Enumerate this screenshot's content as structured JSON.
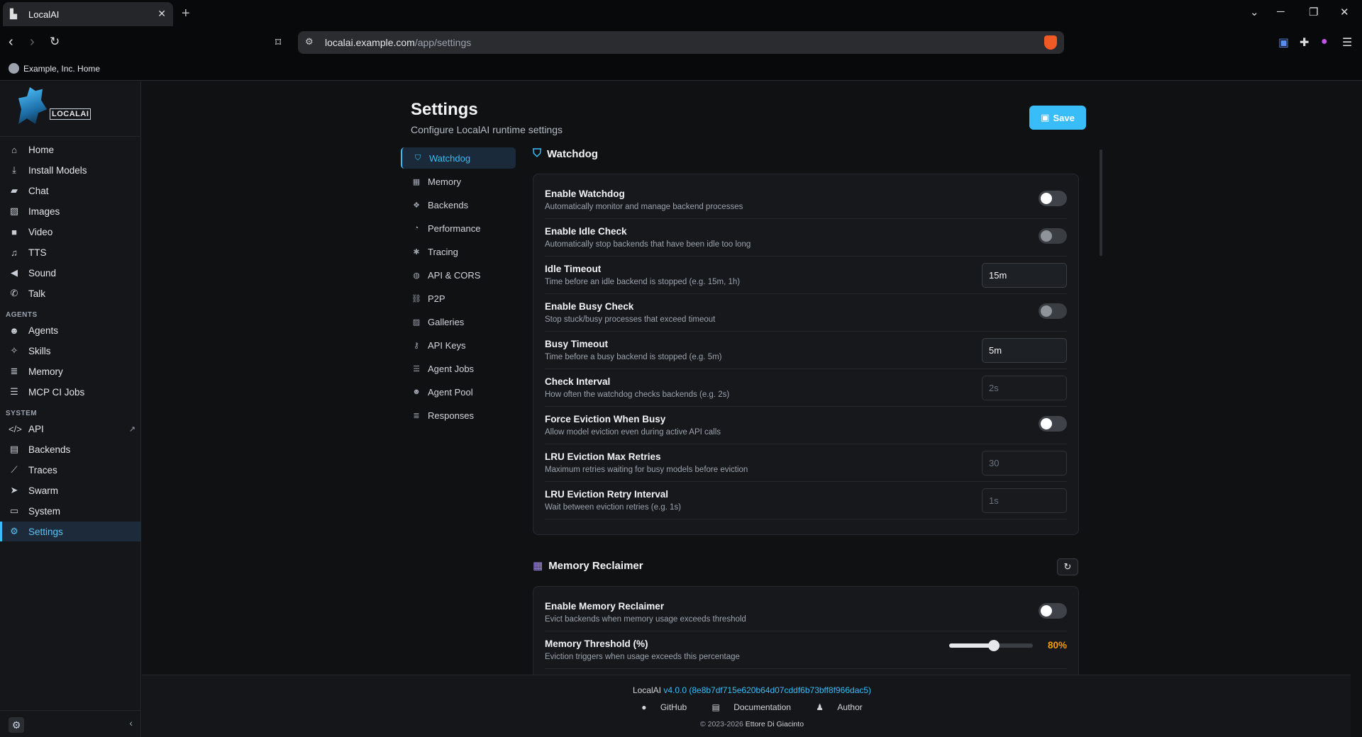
{
  "browser": {
    "tab_title": "LocalAI",
    "url_host": "localai.example.com",
    "url_path": "/app/settings",
    "bookmark": "Example, Inc. Home"
  },
  "sidebar": {
    "logo_text": "LOCALAI",
    "items": [
      {
        "label": "Home",
        "icon": "home-icon"
      },
      {
        "label": "Install Models",
        "icon": "download-icon"
      },
      {
        "label": "Chat",
        "icon": "chat-icon"
      },
      {
        "label": "Images",
        "icon": "image-icon"
      },
      {
        "label": "Video",
        "icon": "video-icon"
      },
      {
        "label": "TTS",
        "icon": "music-icon"
      },
      {
        "label": "Sound",
        "icon": "speaker-icon"
      },
      {
        "label": "Talk",
        "icon": "phone-icon"
      }
    ],
    "agents_heading": "AGENTS",
    "agents_items": [
      {
        "label": "Agents",
        "icon": "robot-icon"
      },
      {
        "label": "Skills",
        "icon": "wand-icon"
      },
      {
        "label": "Memory",
        "icon": "database-icon"
      },
      {
        "label": "MCP CI Jobs",
        "icon": "list-icon"
      }
    ],
    "system_heading": "SYSTEM",
    "system_items": [
      {
        "label": "API",
        "icon": "code-icon"
      },
      {
        "label": "Backends",
        "icon": "server-icon"
      },
      {
        "label": "Traces",
        "icon": "chart-line-icon"
      },
      {
        "label": "Swarm",
        "icon": "send-icon"
      },
      {
        "label": "System",
        "icon": "monitor-icon"
      },
      {
        "label": "Settings",
        "icon": "gear-icon"
      }
    ],
    "active": "Settings"
  },
  "page": {
    "title": "Settings",
    "subtitle": "Configure LocalAI runtime settings",
    "save_label": "Save"
  },
  "subnav": [
    {
      "label": "Watchdog",
      "icon": "shield-icon"
    },
    {
      "label": "Memory",
      "icon": "memory-icon"
    },
    {
      "label": "Backends",
      "icon": "cubes-icon"
    },
    {
      "label": "Performance",
      "icon": "gauge-icon"
    },
    {
      "label": "Tracing",
      "icon": "bug-icon"
    },
    {
      "label": "API & CORS",
      "icon": "globe-icon"
    },
    {
      "label": "P2P",
      "icon": "network-icon"
    },
    {
      "label": "Galleries",
      "icon": "images-icon"
    },
    {
      "label": "API Keys",
      "icon": "key-icon"
    },
    {
      "label": "Agent Jobs",
      "icon": "list-check-icon"
    },
    {
      "label": "Agent Pool",
      "icon": "users-icon"
    },
    {
      "label": "Responses",
      "icon": "database-icon"
    }
  ],
  "watchdog": {
    "title": "Watchdog",
    "rows": [
      {
        "label": "Enable Watchdog",
        "desc": "Automatically monitor and manage backend processes",
        "type": "toggle",
        "enabled": true
      },
      {
        "label": "Enable Idle Check",
        "desc": "Automatically stop backends that have been idle too long",
        "type": "toggle",
        "enabled": false
      },
      {
        "label": "Idle Timeout",
        "desc": "Time before an idle backend is stopped (e.g. 15m, 1h)",
        "type": "input",
        "value": "15m"
      },
      {
        "label": "Enable Busy Check",
        "desc": "Stop stuck/busy processes that exceed timeout",
        "type": "toggle",
        "enabled": false
      },
      {
        "label": "Busy Timeout",
        "desc": "Time before a busy backend is stopped (e.g. 5m)",
        "type": "input",
        "value": "5m"
      },
      {
        "label": "Check Interval",
        "desc": "How often the watchdog checks backends (e.g. 2s)",
        "type": "input",
        "placeholder": "2s"
      },
      {
        "label": "Force Eviction When Busy",
        "desc": "Allow model eviction even during active API calls",
        "type": "toggle",
        "enabled": true
      },
      {
        "label": "LRU Eviction Max Retries",
        "desc": "Maximum retries waiting for busy models before eviction",
        "type": "input",
        "placeholder": "30"
      },
      {
        "label": "LRU Eviction Retry Interval",
        "desc": "Wait between eviction retries (e.g. 1s)",
        "type": "input",
        "placeholder": "1s"
      }
    ]
  },
  "memory_reclaimer": {
    "title": "Memory Reclaimer",
    "enable_label": "Enable Memory Reclaimer",
    "enable_desc": "Evict backends when memory usage exceeds threshold",
    "threshold_label": "Memory Threshold (%)",
    "threshold_desc": "Eviction triggers when usage exceeds this percentage",
    "threshold_value": 80,
    "threshold_display": "80%"
  },
  "footer": {
    "app": "LocalAI",
    "version": "v4.0.0 (8e8b7df715e620b64d07cddf6b73bff8f966dac5)",
    "github": "GitHub",
    "docs": "Documentation",
    "author_link": "Author",
    "copyright": "© 2023-2026",
    "author": "Ettore Di Giacinto"
  },
  "colors": {
    "accent": "#38bdf8",
    "warning": "#f59e0b",
    "background": "#101113"
  }
}
